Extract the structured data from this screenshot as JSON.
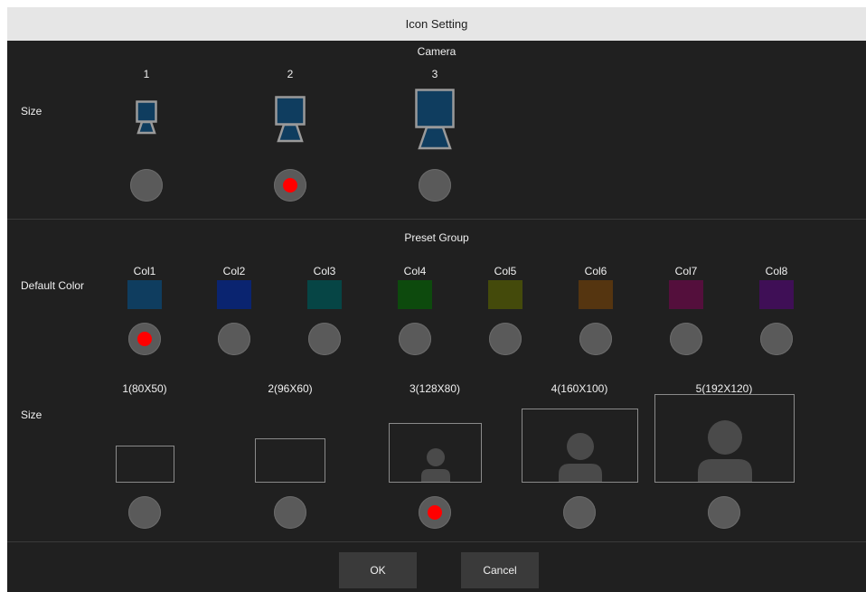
{
  "dialog": {
    "title": "Icon Setting"
  },
  "camera": {
    "section_title": "Camera",
    "size_label": "Size",
    "options": [
      {
        "label": "1",
        "icon": "camera-small-icon",
        "selected": false
      },
      {
        "label": "2",
        "icon": "camera-medium-icon",
        "selected": true
      },
      {
        "label": "3",
        "icon": "camera-large-icon",
        "selected": false
      }
    ]
  },
  "preset_group": {
    "section_title": "Preset Group",
    "default_color_label": "Default Color",
    "colors": [
      {
        "label": "Col1",
        "color": "#0f3d5f",
        "selected": true
      },
      {
        "label": "Col2",
        "color": "#0a2470",
        "selected": false
      },
      {
        "label": "Col3",
        "color": "#064545",
        "selected": false
      },
      {
        "label": "Col4",
        "color": "#0d4a0d",
        "selected": false
      },
      {
        "label": "Col5",
        "color": "#444a0b",
        "selected": false
      },
      {
        "label": "Col6",
        "color": "#553510",
        "selected": false
      },
      {
        "label": "Col7",
        "color": "#540f3c",
        "selected": false
      },
      {
        "label": "Col8",
        "color": "#3f0f56",
        "selected": false
      }
    ],
    "size_label": "Size",
    "sizes": [
      {
        "label": "1(80X50)",
        "selected": false
      },
      {
        "label": "2(96X60)",
        "selected": false
      },
      {
        "label": "3(128X80)",
        "selected": true
      },
      {
        "label": "4(160X100)",
        "selected": false
      },
      {
        "label": "5(192X120)",
        "selected": false
      }
    ]
  },
  "buttons": {
    "ok": "OK",
    "cancel": "Cancel"
  },
  "colors": {
    "background": "#202020",
    "titlebar": "#e6e6e6",
    "radio": "#5a5a5a",
    "radio_selected_dot": "#ff0000",
    "camera_icon_fill": "#0f3d5f",
    "camera_icon_stroke": "#9a9a9a"
  }
}
